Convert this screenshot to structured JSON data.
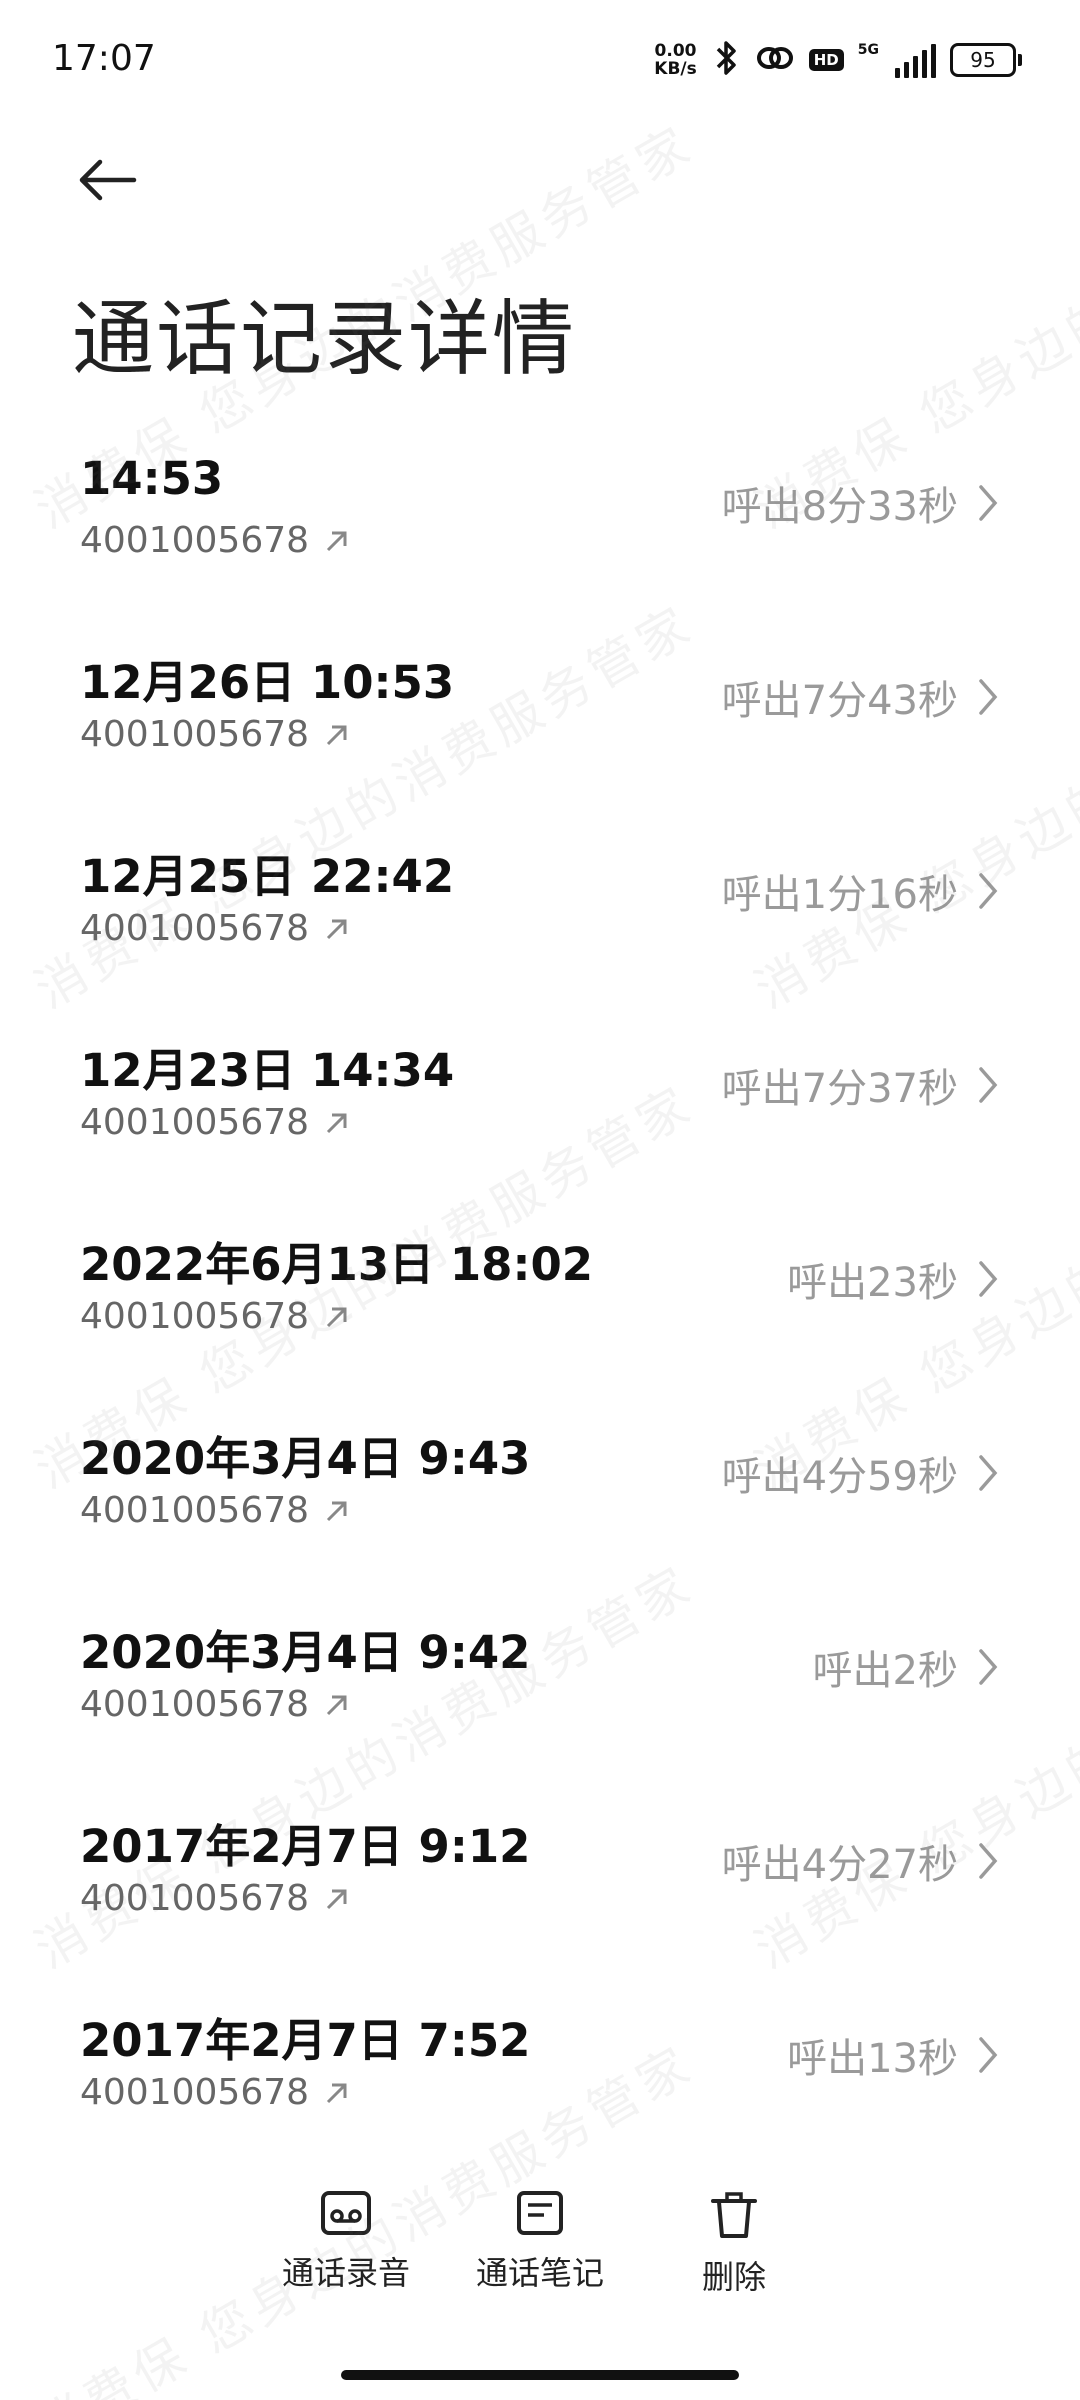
{
  "status_bar": {
    "time": "17:07",
    "net_speed_value": "0.00",
    "net_speed_unit": "KB/s",
    "hd_label": "HD",
    "network_type": "5G",
    "battery_level": "95",
    "icons": [
      "bluetooth-icon",
      "link-icon",
      "hd-icon",
      "signal-icon",
      "battery-icon"
    ]
  },
  "header": {
    "back_icon": "back-arrow-icon",
    "title": "通话记录详情"
  },
  "calls": [
    {
      "time": "14:53",
      "number": "4001005678",
      "duration": "呼出8分33秒"
    },
    {
      "time": "12月26日 10:53",
      "number": "4001005678",
      "duration": "呼出7分43秒"
    },
    {
      "time": "12月25日 22:42",
      "number": "4001005678",
      "duration": "呼出1分16秒"
    },
    {
      "time": "12月23日 14:34",
      "number": "4001005678",
      "duration": "呼出7分37秒"
    },
    {
      "time": "2022年6月13日 18:02",
      "number": "4001005678",
      "duration": "呼出23秒"
    },
    {
      "time": "2020年3月4日 9:43",
      "number": "4001005678",
      "duration": "呼出4分59秒"
    },
    {
      "time": "2020年3月4日 9:42",
      "number": "4001005678",
      "duration": "呼出2秒"
    },
    {
      "time": "2017年2月7日 9:12",
      "number": "4001005678",
      "duration": "呼出4分27秒"
    },
    {
      "time": "2017年2月7日 7:52",
      "number": "4001005678",
      "duration": "呼出13秒"
    }
  ],
  "bottom_actions": {
    "record": "通话录音",
    "notes": "通话笔记",
    "delete": "删除"
  },
  "watermark": {
    "line1": "消费保 您身边的消费服务管家",
    "color": "#8a8a8a"
  },
  "colors": {
    "primary_text": "#111111",
    "secondary_text": "#666666",
    "duration_text": "#9a9a9a",
    "background": "#ffffff"
  }
}
